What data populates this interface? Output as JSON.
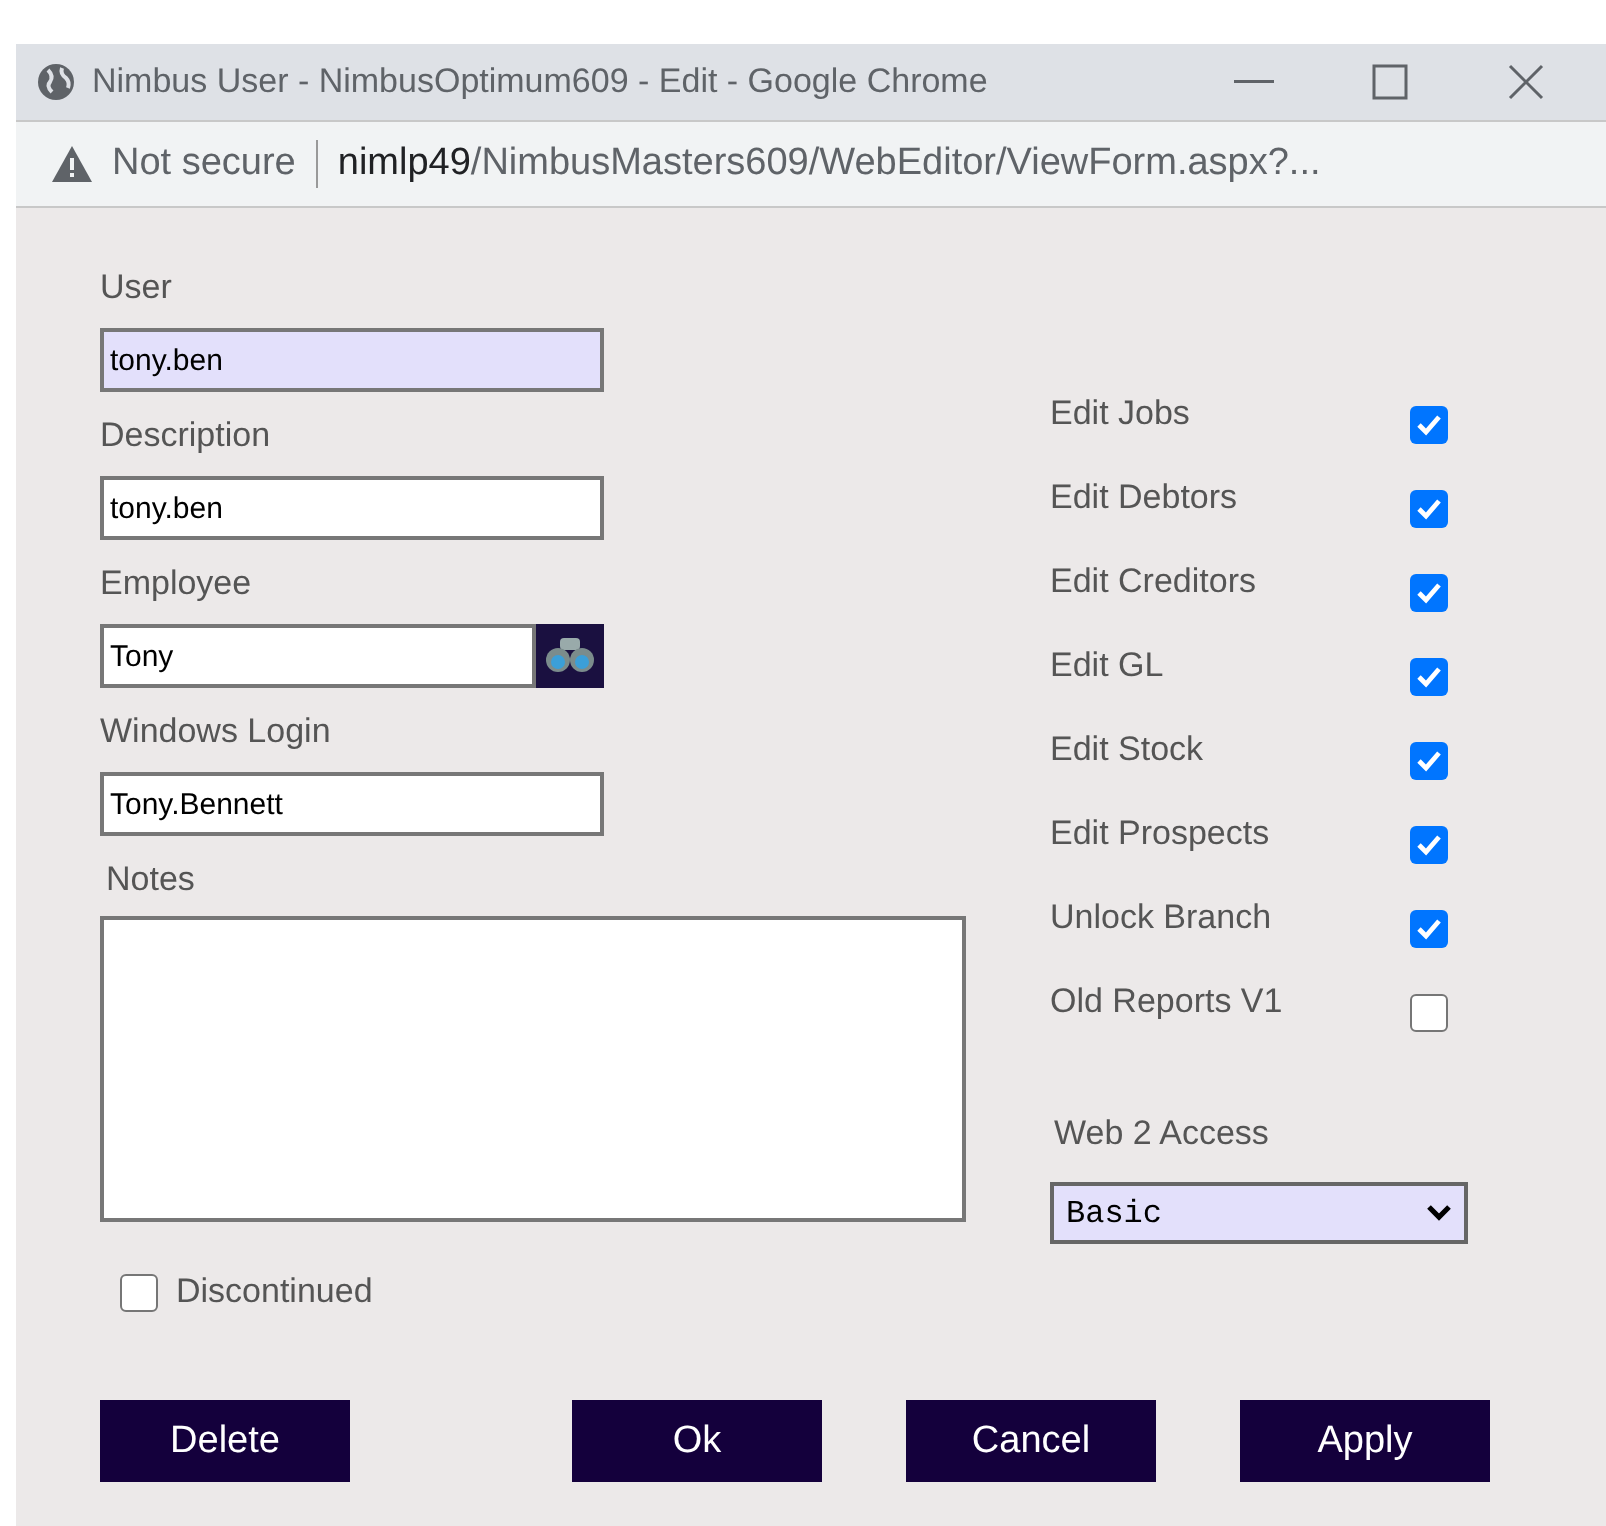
{
  "window": {
    "title": "Nimbus User - NimbusOptimum609 - Edit - Google Chrome"
  },
  "address_bar": {
    "security": "Not secure",
    "host": "nimlp49",
    "path": "/NimbusMasters609/WebEditor/ViewForm.aspx?..."
  },
  "fields": [
    {
      "label": "User",
      "value": "tony.ben",
      "focused": true,
      "lookup": false
    },
    {
      "label": "Description",
      "value": "tony.ben",
      "focused": false,
      "lookup": false
    },
    {
      "label": "Employee",
      "value": "Tony",
      "focused": false,
      "lookup": true
    },
    {
      "label": "Windows Login",
      "value": "Tony.Bennett",
      "focused": false,
      "lookup": false
    }
  ],
  "notes": {
    "label": "Notes"
  },
  "discontinued": {
    "label": "Discontinued",
    "checked": false
  },
  "permissions": [
    {
      "label": "Edit Jobs",
      "checked": true
    },
    {
      "label": "Edit Debtors",
      "checked": true
    },
    {
      "label": "Edit Creditors",
      "checked": true
    },
    {
      "label": "Edit GL",
      "checked": true
    },
    {
      "label": "Edit Stock",
      "checked": true
    },
    {
      "label": "Edit Prospects",
      "checked": true
    },
    {
      "label": "Unlock Branch",
      "checked": true
    },
    {
      "label": "Old Reports V1",
      "checked": false
    }
  ],
  "web2_access": {
    "label": "Web 2 Access",
    "value": "Basic"
  },
  "buttons": [
    {
      "label": "Delete",
      "kind": "left"
    },
    {
      "label": "Ok",
      "kind": "right"
    },
    {
      "label": "Cancel",
      "kind": "right"
    },
    {
      "label": "Apply",
      "kind": "right"
    }
  ]
}
